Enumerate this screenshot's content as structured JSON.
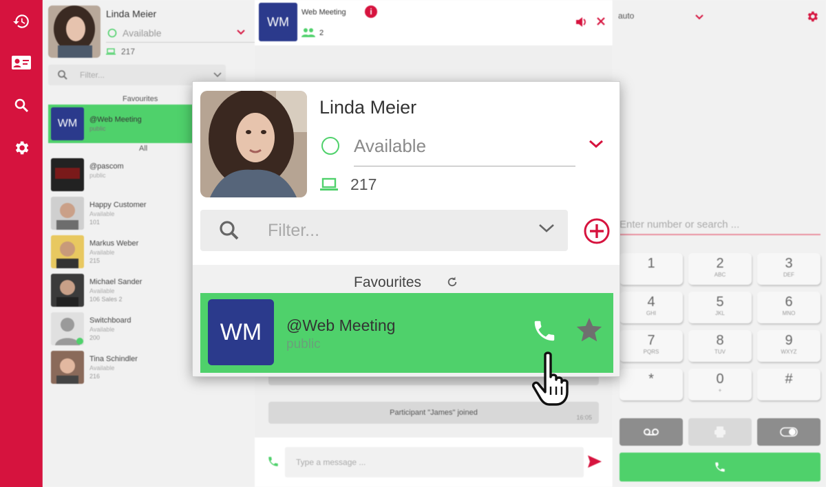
{
  "me": {
    "name": "Linda Meier",
    "status": "Available",
    "extension": "217"
  },
  "filter": {
    "placeholder": "Filter..."
  },
  "sections": {
    "favourites": "Favourites",
    "all": "All"
  },
  "favourite": {
    "initials": "WM",
    "title": "@Web Meeting",
    "subtitle": "public"
  },
  "contacts": [
    {
      "name": "@pascom",
      "sub": "public",
      "ext": ""
    },
    {
      "name": "Happy Customer",
      "sub": "Available",
      "ext": "101"
    },
    {
      "name": "Markus Weber",
      "sub": "Available",
      "ext": "215"
    },
    {
      "name": "Michael Sander",
      "sub": "Available",
      "ext": "106  Sales 2"
    },
    {
      "name": "Switchboard",
      "sub": "Available",
      "ext": "200"
    },
    {
      "name": "Tina Schindler",
      "sub": "Available",
      "ext": "216"
    }
  ],
  "chat": {
    "initials": "WM",
    "title": "Web Meeting",
    "participants": "2",
    "info_badge": "i",
    "message": "Participant \"James\" joined",
    "message_time": "16:05",
    "input_placeholder": "Type a message ..."
  },
  "dialer": {
    "mode": "auto",
    "placeholder": "Enter number or search ...",
    "keys": [
      {
        "d": "1",
        "l": ""
      },
      {
        "d": "2",
        "l": "ABC"
      },
      {
        "d": "3",
        "l": "DEF"
      },
      {
        "d": "4",
        "l": "GHI"
      },
      {
        "d": "5",
        "l": "JKL"
      },
      {
        "d": "6",
        "l": "MNO"
      },
      {
        "d": "7",
        "l": "PQRS"
      },
      {
        "d": "8",
        "l": "TUV"
      },
      {
        "d": "9",
        "l": "WXYZ"
      },
      {
        "d": "*",
        "l": ""
      },
      {
        "d": "0",
        "l": "+"
      },
      {
        "d": "#",
        "l": ""
      }
    ]
  },
  "colors": {
    "brand": "#d6133e",
    "online": "#4fd16b",
    "meeting": "#2b3a8c"
  }
}
